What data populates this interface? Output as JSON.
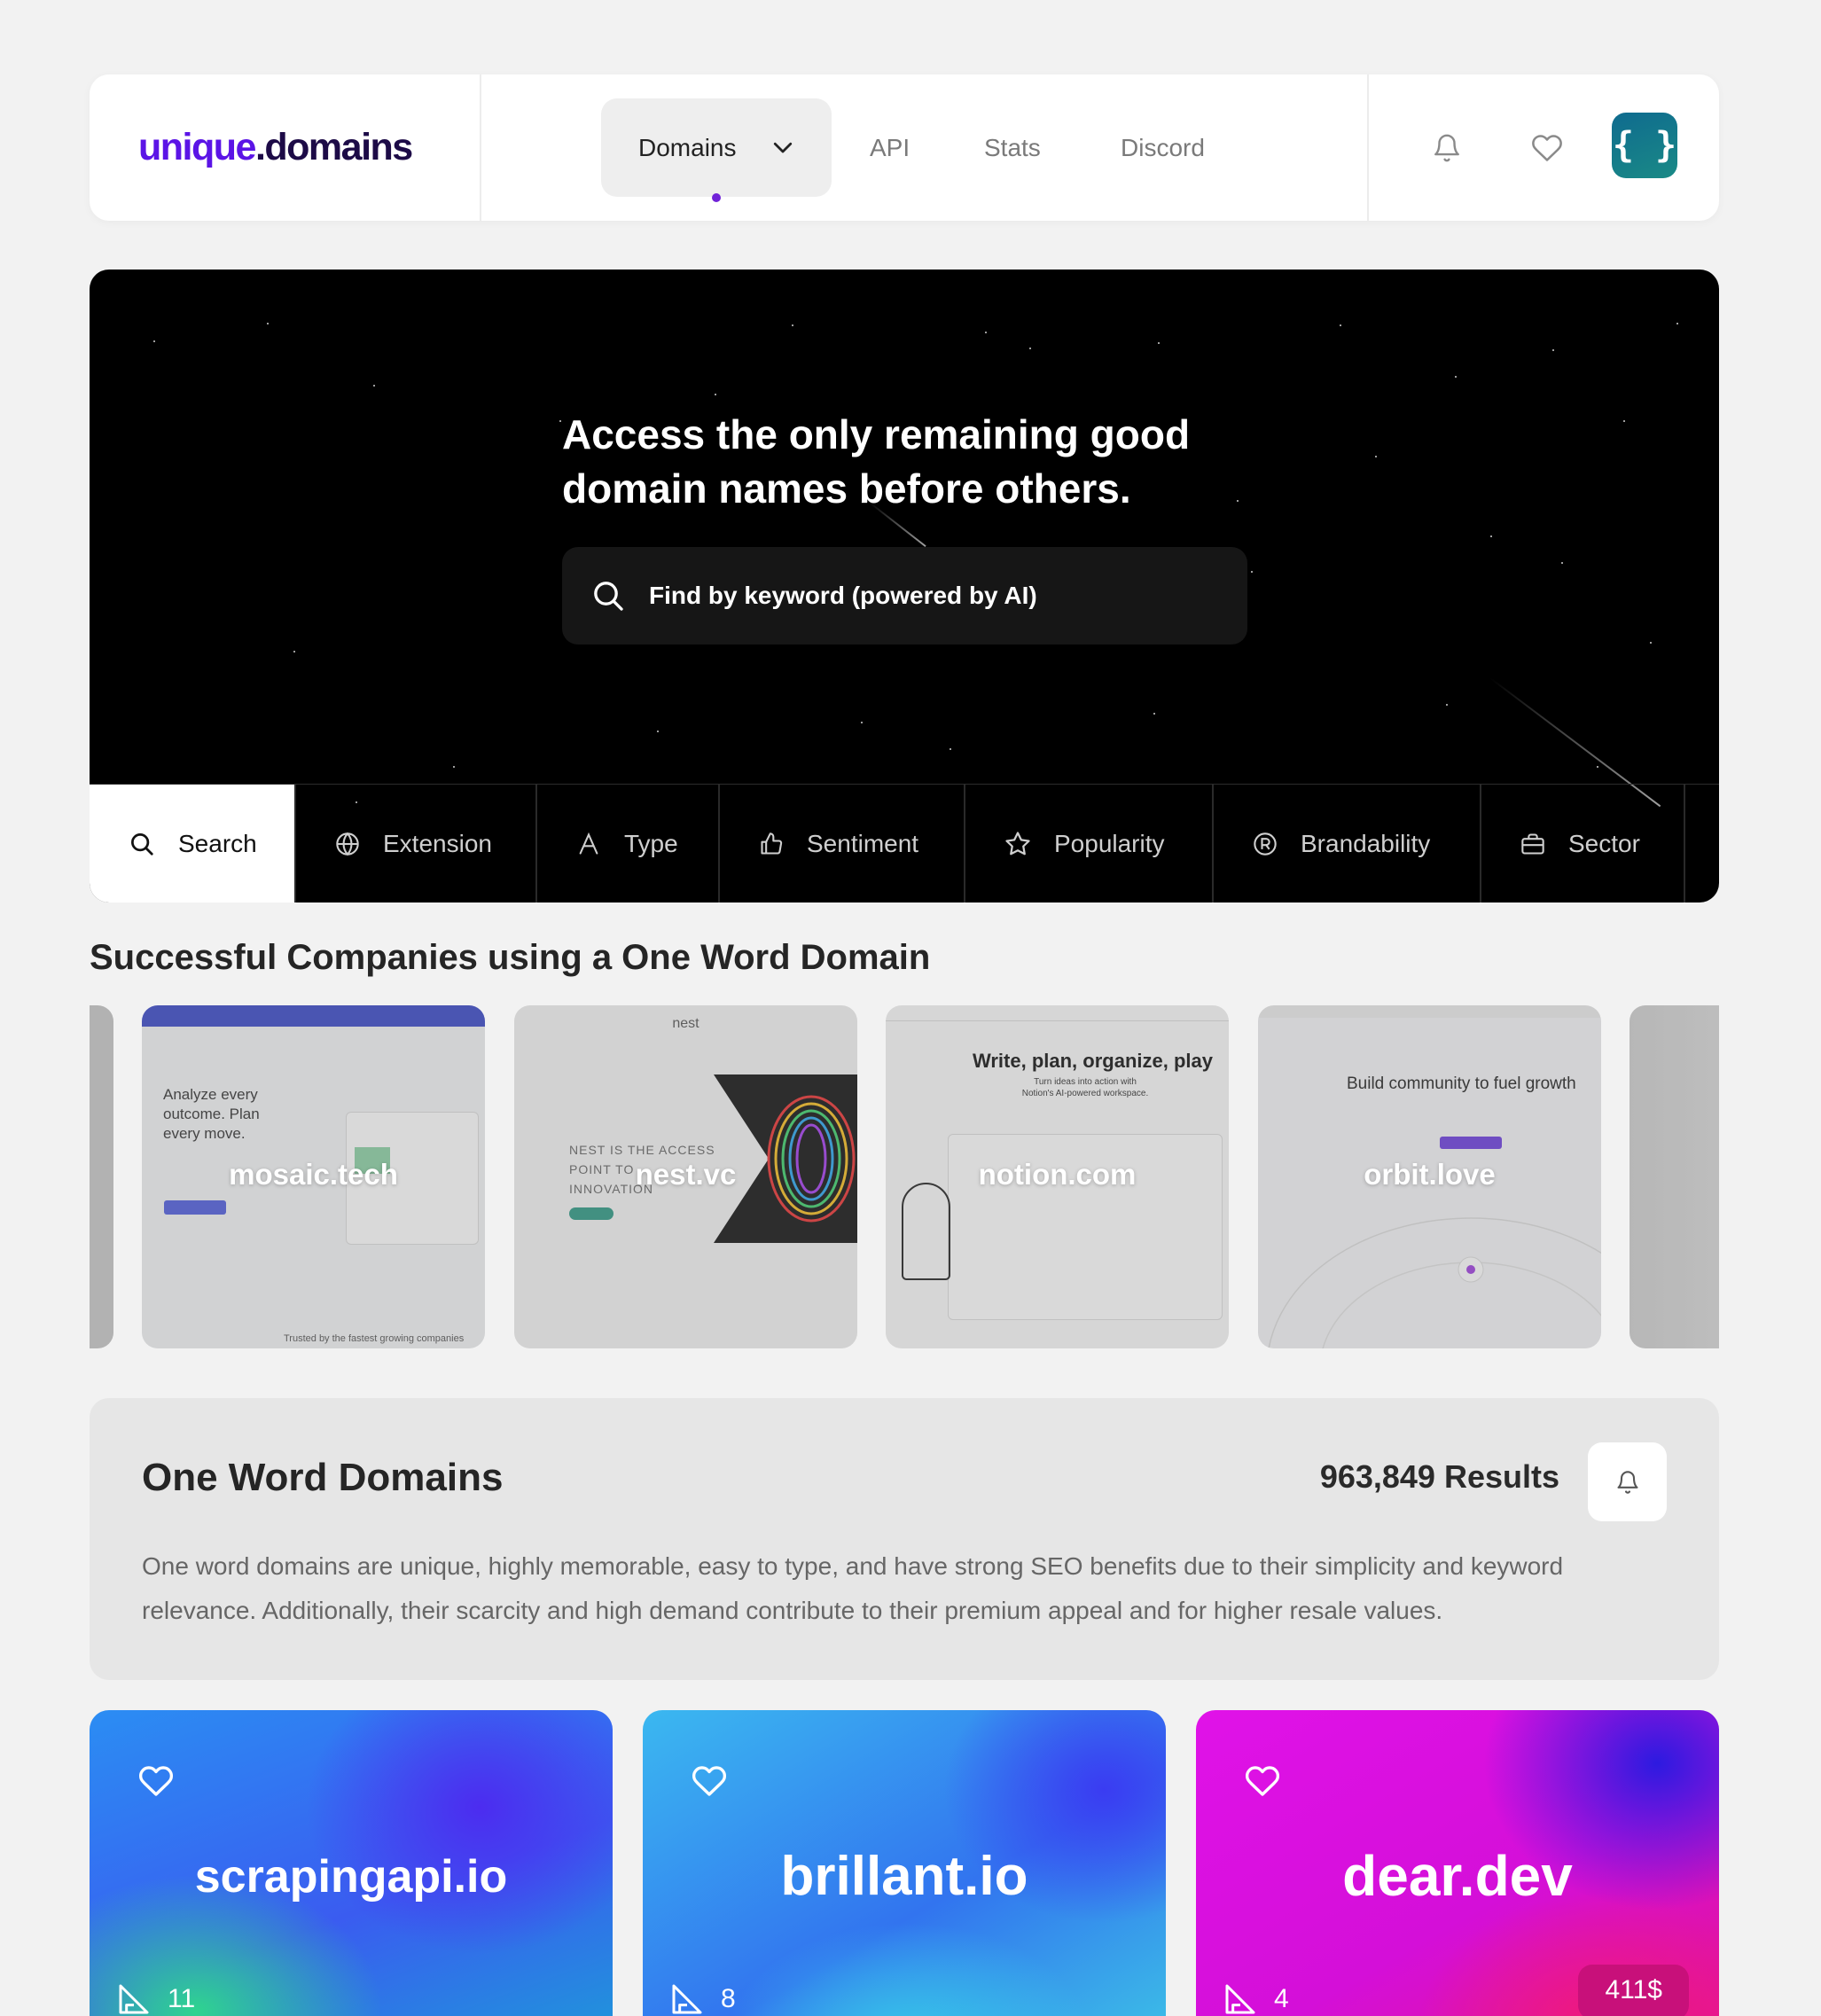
{
  "nav": {
    "logo_part1": "unique",
    "logo_part2": ".domains",
    "domains_label": "Domains",
    "links": [
      "API",
      "Stats",
      "Discord"
    ],
    "avatar_text": "{ }"
  },
  "hero": {
    "headline": "Access the only remaining good domain names before others.",
    "search_placeholder": "Find by keyword (powered by AI)",
    "tabs": [
      {
        "label": "Search",
        "icon": "search-icon"
      },
      {
        "label": "Extension",
        "icon": "globe-icon"
      },
      {
        "label": "Type",
        "icon": "font-icon"
      },
      {
        "label": "Sentiment",
        "icon": "thumbs-up-icon"
      },
      {
        "label": "Popularity",
        "icon": "star-icon"
      },
      {
        "label": "Brandability",
        "icon": "registered-icon"
      },
      {
        "label": "Sector",
        "icon": "briefcase-icon"
      }
    ]
  },
  "companies": {
    "title": "Successful Companies using a One Word Domain",
    "items": [
      {
        "name": "mosaic.tech",
        "headline": "Analyze every outcome. Plan every move.",
        "footer": "Trusted by the fastest growing companies"
      },
      {
        "name": "nest.vc",
        "brand": "nest",
        "headline": "NEST IS THE ACCESS POINT TO INNOVATION"
      },
      {
        "name": "notion.com",
        "headline": "Write, plan, organize, play",
        "subline": "Turn ideas into action with Notion's AI-powered workspace."
      },
      {
        "name": "orbit.love",
        "headline": "Build community to fuel growth"
      }
    ]
  },
  "panel": {
    "title": "One Word Domains",
    "results": "963,849 Results",
    "description": "One word domains are unique, highly memorable, easy to type, and have strong SEO benefits due to their simplicity and keyword relevance. Additionally, their scarcity and high demand contribute to their premium appeal and for higher resale values."
  },
  "domains": [
    {
      "name": "scrapingapi.io",
      "length": "11",
      "price": ""
    },
    {
      "name": "brillant.io",
      "length": "8",
      "price": ""
    },
    {
      "name": "dear.dev",
      "length": "4",
      "price": "411$"
    }
  ],
  "colors": {
    "brand_purple": "#5b14e6",
    "brand_navy": "#1d0b47",
    "active_dot": "#7022d8",
    "avatar_teal": "#0f6b8f"
  }
}
